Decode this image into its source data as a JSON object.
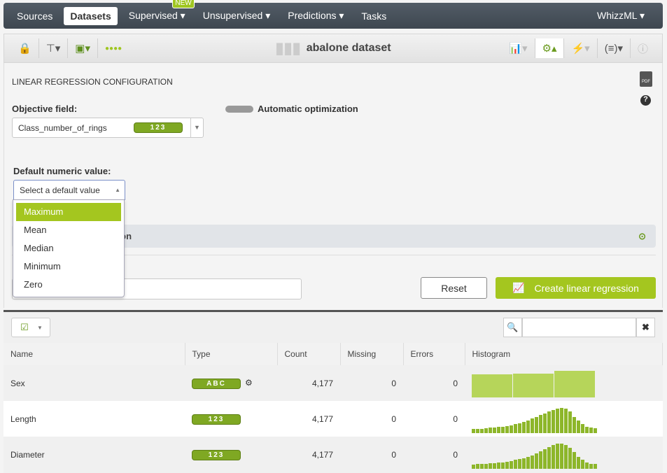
{
  "nav": {
    "items": [
      "Sources",
      "Datasets",
      "Supervised",
      "Unsupervised",
      "Predictions",
      "Tasks"
    ],
    "active": "Datasets",
    "new_badge": "NEW",
    "right": "WhizzML"
  },
  "toolbar": {
    "title": "abalone dataset"
  },
  "config": {
    "section_title": "LINEAR REGRESSION CONFIGURATION",
    "objective_label": "Objective field:",
    "objective_value": "Class_number_of_rings",
    "objective_type": "123",
    "auto_opt_label": "Automatic optimization",
    "auto_opt_on": false,
    "default_numeric_label": "Default numeric value:",
    "default_numeric_placeholder": "Select a default value",
    "options": [
      "Maximum",
      "Mean",
      "Median",
      "Minimum",
      "Zero"
    ],
    "highlighted_option": "Maximum",
    "advanced_partial": "ation",
    "reset": "Reset",
    "create": "Create linear regression"
  },
  "colors": {
    "accent": "#a4c61f",
    "nav": "#48515a"
  },
  "table": {
    "headers": [
      "Name",
      "Type",
      "Count",
      "Missing",
      "Errors",
      "Histogram"
    ],
    "rows": [
      {
        "name": "Sex",
        "type": "ABC",
        "count": "4,177",
        "missing": "0",
        "errors": "0",
        "hist": [
          1307,
          1342,
          1528
        ]
      },
      {
        "name": "Length",
        "type": "123",
        "count": "4,177",
        "missing": "0",
        "errors": "0",
        "hist": [
          10,
          10,
          10,
          12,
          15,
          15,
          18,
          20,
          22,
          25,
          30,
          35,
          40,
          45,
          55,
          60,
          70,
          75,
          85,
          90,
          95,
          100,
          95,
          85,
          60,
          45,
          30,
          20,
          15,
          12
        ]
      },
      {
        "name": "Diameter",
        "type": "123",
        "count": "4,177",
        "missing": "0",
        "errors": "0",
        "hist": [
          10,
          12,
          12,
          14,
          15,
          17,
          18,
          20,
          22,
          26,
          30,
          34,
          38,
          44,
          50,
          58,
          66,
          74,
          84,
          92,
          100,
          98,
          92,
          80,
          62,
          44,
          30,
          20,
          14,
          12
        ]
      }
    ]
  }
}
